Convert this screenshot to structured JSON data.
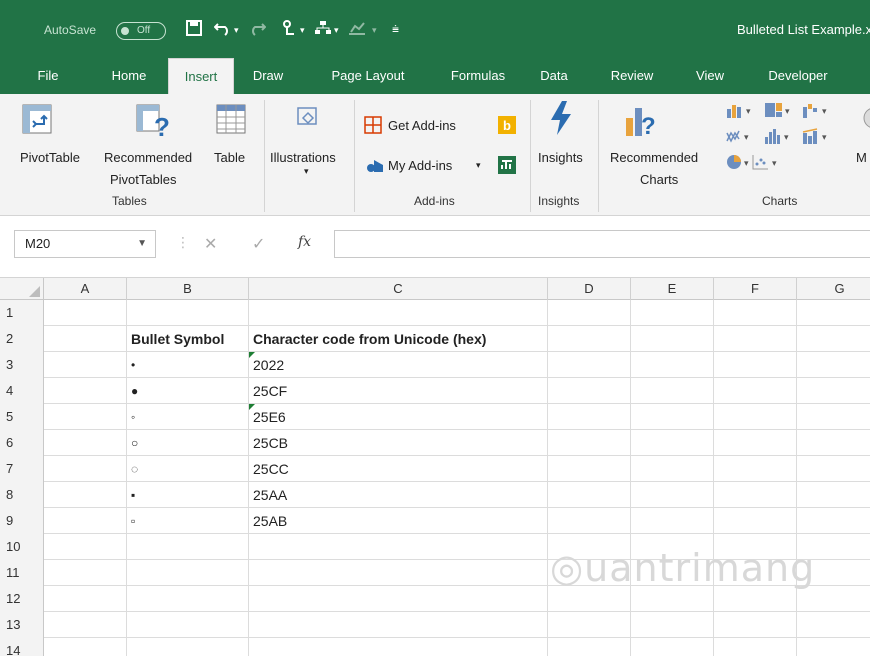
{
  "titlebar": {
    "autosave_label": "AutoSave",
    "autosave_state": "Off",
    "doc_title": "Bulleted List Example.xlsx",
    "qat_icons": [
      "save-icon",
      "undo-icon",
      "redo-icon",
      "touch-mode-icon",
      "hierarchy-icon",
      "chart-icon",
      "customize-qat-icon"
    ]
  },
  "tabs": [
    "File",
    "Home",
    "Insert",
    "Draw",
    "Page Layout",
    "Formulas",
    "Data",
    "Review",
    "View",
    "Developer"
  ],
  "active_tab": "Insert",
  "ribbon": {
    "tables": {
      "pivot": "PivotTable",
      "rec_line1": "Recommended",
      "rec_line2": "PivotTables",
      "table": "Table",
      "group": "Tables"
    },
    "illustrations": {
      "label": "Illustrations",
      "dd": "▾"
    },
    "addins": {
      "get": "Get Add-ins",
      "my": "My Add-ins",
      "dd": "▾",
      "group": "Add-ins"
    },
    "insights": {
      "label": "Insights",
      "group": "Insights"
    },
    "charts": {
      "rec_line1": "Recommended",
      "rec_line2": "Charts",
      "group": "Charts",
      "more": "M"
    }
  },
  "formula_bar": {
    "name_box": "M20",
    "cancel": "✕",
    "enter": "✓",
    "fx": "fx",
    "value": ""
  },
  "columns": [
    "A",
    "B",
    "C",
    "D",
    "E",
    "F",
    "G"
  ],
  "rows": [
    {
      "num": "1",
      "b": "",
      "c": ""
    },
    {
      "num": "2",
      "b": "Bullet Symbol",
      "c": "Character code from Unicode (hex)"
    },
    {
      "num": "3",
      "b": "•",
      "c": "2022"
    },
    {
      "num": "4",
      "b": "●",
      "c": "25CF"
    },
    {
      "num": "5",
      "b": "◦",
      "c": "25E6"
    },
    {
      "num": "6",
      "b": "○",
      "c": "25CB"
    },
    {
      "num": "7",
      "b": "◌",
      "c": "25CC"
    },
    {
      "num": "8",
      "b": "▪",
      "c": "25AA"
    },
    {
      "num": "9",
      "b": "▫",
      "c": "25AB"
    },
    {
      "num": "10",
      "b": "",
      "c": ""
    },
    {
      "num": "11",
      "b": "",
      "c": ""
    },
    {
      "num": "12",
      "b": "",
      "c": ""
    },
    {
      "num": "13",
      "b": "",
      "c": ""
    },
    {
      "num": "14",
      "b": "",
      "c": ""
    }
  ],
  "colors": {
    "excel_green": "#217346",
    "ribbon_bg": "#f3f3f3"
  }
}
